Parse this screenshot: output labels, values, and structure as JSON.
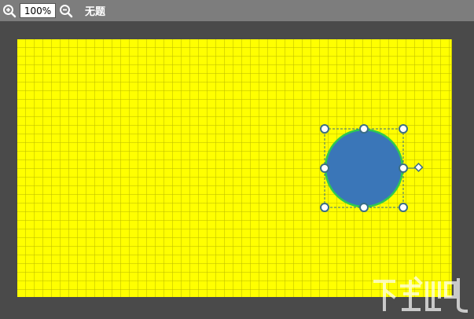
{
  "toolbar": {
    "zoom_in_icon": "zoom-in-icon",
    "zoom_value": "100%",
    "zoom_out_icon": "zoom-out-icon",
    "document_title": "无题"
  },
  "canvas": {
    "background_color": "#ffff00",
    "grid_visible": true
  },
  "selected_shape": {
    "type": "circle",
    "fill_color": "#3a76b8",
    "stroke_color": "#2fc850",
    "handle_color": "#3a6e86"
  }
}
